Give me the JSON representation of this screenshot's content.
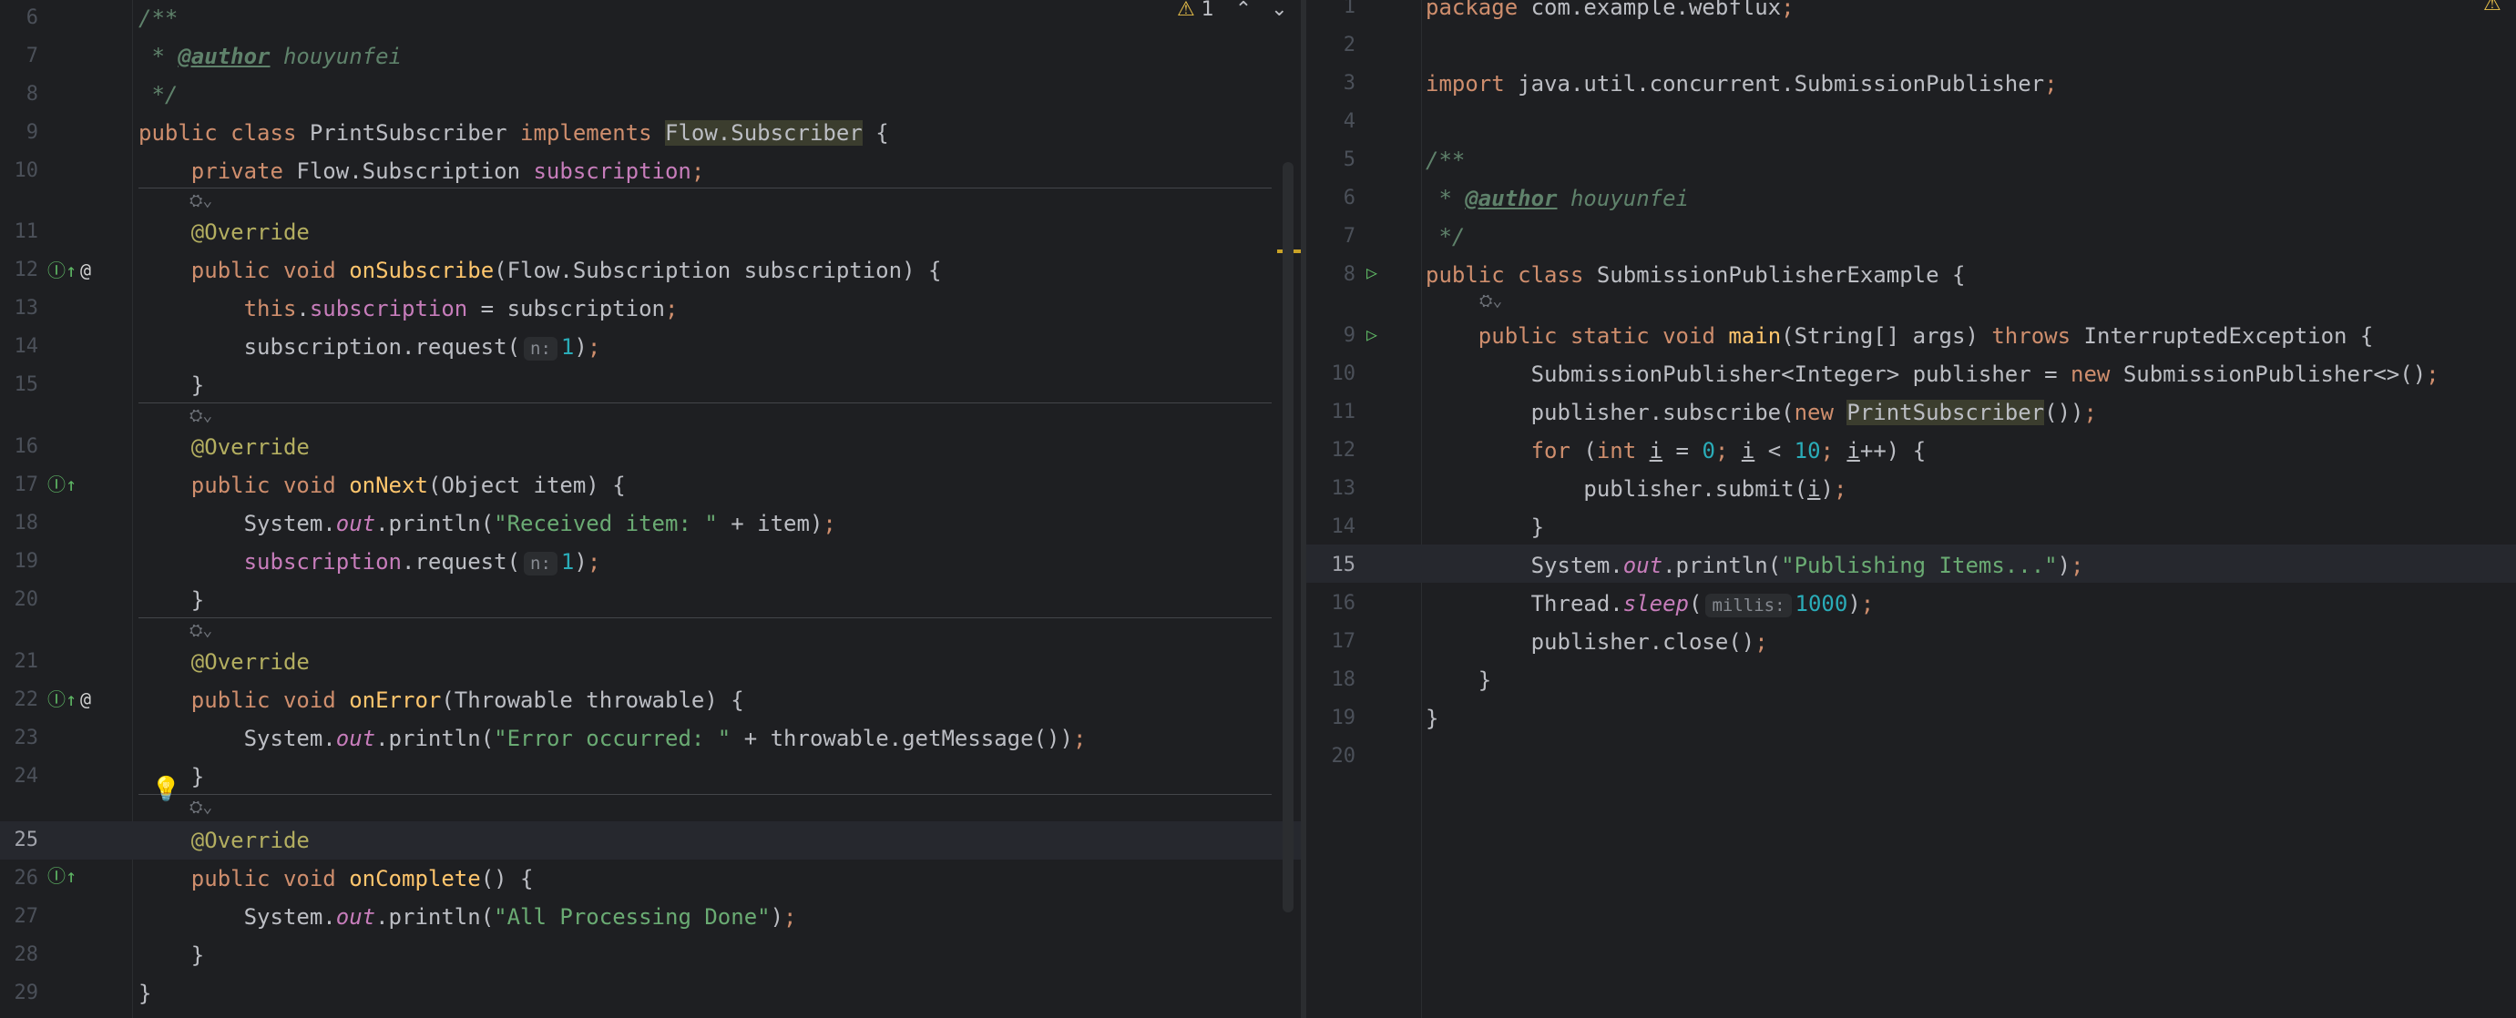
{
  "left": {
    "warnings": {
      "count": "1",
      "icon": "warning-icon"
    },
    "lines": [
      {
        "n": "6",
        "tokens": [
          [
            "/**",
            "cmt2"
          ]
        ]
      },
      {
        "n": "7",
        "tokens": [
          [
            " * ",
            "cmt2"
          ],
          [
            "@author",
            "tag"
          ],
          [
            " houyunfei",
            "cmt2"
          ]
        ]
      },
      {
        "n": "8",
        "tokens": [
          [
            " */",
            "cmt2"
          ]
        ]
      },
      {
        "n": "9",
        "tokens": [
          [
            "public ",
            "kw"
          ],
          [
            "class ",
            "kw"
          ],
          [
            "PrintSubscriber ",
            "cls"
          ],
          [
            "implements ",
            "kw"
          ],
          [
            "Flow.Subscriber",
            "hl"
          ],
          [
            " {",
            ""
          ]
        ]
      },
      {
        "n": "10",
        "tokens": [
          [
            "    private ",
            "kw"
          ],
          [
            "Flow.Subscription ",
            "cls"
          ],
          [
            "subscription",
            "fld"
          ],
          [
            ";",
            "kw"
          ]
        ]
      },
      {
        "n": "11",
        "tokens": [
          [
            "    @Override",
            "ann"
          ]
        ]
      },
      {
        "n": "12",
        "tokens": [
          [
            "    public ",
            "kw"
          ],
          [
            "void ",
            "kw"
          ],
          [
            "onSubscribe",
            "fn2"
          ],
          [
            "(Flow.Subscription subscription) {",
            ""
          ]
        ]
      },
      {
        "n": "13",
        "tokens": [
          [
            "        this",
            "kw"
          ],
          [
            ".",
            ""
          ],
          [
            "subscription",
            "fld"
          ],
          [
            " = subscription",
            ""
          ],
          [
            ";",
            "kw"
          ]
        ]
      },
      {
        "n": "14",
        "tokens": [
          [
            "        subscription.request(",
            ""
          ],
          [
            "n:",
            "inl"
          ],
          [
            "1",
            "num2"
          ],
          [
            ")",
            ""
          ],
          [
            ";",
            "kw"
          ]
        ]
      },
      {
        "n": "15",
        "tokens": [
          [
            "    }",
            ""
          ]
        ]
      },
      {
        "n": "16",
        "tokens": [
          [
            "    @Override",
            "ann"
          ]
        ]
      },
      {
        "n": "17",
        "tokens": [
          [
            "    public ",
            "kw"
          ],
          [
            "void ",
            "kw"
          ],
          [
            "onNext",
            "fn2"
          ],
          [
            "(Object item) {",
            ""
          ]
        ]
      },
      {
        "n": "18",
        "tokens": [
          [
            "        System.",
            ""
          ],
          [
            "out",
            "stat"
          ],
          [
            ".println(",
            ""
          ],
          [
            "\"Received item: \"",
            "str"
          ],
          [
            " + item)",
            ""
          ],
          [
            ";",
            "kw"
          ]
        ]
      },
      {
        "n": "19",
        "tokens": [
          [
            "        ",
            ""
          ],
          [
            "subscription",
            "fld"
          ],
          [
            ".request(",
            ""
          ],
          [
            "n:",
            "inl"
          ],
          [
            "1",
            "num2"
          ],
          [
            ")",
            ""
          ],
          [
            ";",
            "kw"
          ]
        ]
      },
      {
        "n": "20",
        "tokens": [
          [
            "    }",
            ""
          ]
        ]
      },
      {
        "n": "21",
        "tokens": [
          [
            "    @Override",
            "ann"
          ]
        ]
      },
      {
        "n": "22",
        "tokens": [
          [
            "    public ",
            "kw"
          ],
          [
            "void ",
            "kw"
          ],
          [
            "onError",
            "fn2"
          ],
          [
            "(Throwable throwable) {",
            ""
          ]
        ]
      },
      {
        "n": "23",
        "tokens": [
          [
            "        System.",
            ""
          ],
          [
            "out",
            "stat"
          ],
          [
            ".println(",
            ""
          ],
          [
            "\"Error occurred: \"",
            "str"
          ],
          [
            " + throwable.getMessage())",
            ""
          ],
          [
            ";",
            "kw"
          ]
        ]
      },
      {
        "n": "24",
        "tokens": [
          [
            "    }",
            ""
          ]
        ]
      },
      {
        "n": "25",
        "tokens": [
          [
            "    @Override",
            "ann"
          ]
        ]
      },
      {
        "n": "26",
        "tokens": [
          [
            "    public ",
            "kw"
          ],
          [
            "void ",
            "kw"
          ],
          [
            "onComplete",
            "fn2"
          ],
          [
            "() {",
            ""
          ]
        ]
      },
      {
        "n": "27",
        "tokens": [
          [
            "        System.",
            ""
          ],
          [
            "out",
            "stat"
          ],
          [
            ".println(",
            ""
          ],
          [
            "\"All Processing Done\"",
            "str"
          ],
          [
            ")",
            ""
          ],
          [
            ";",
            "kw"
          ]
        ]
      },
      {
        "n": "28",
        "tokens": [
          [
            "    }",
            ""
          ]
        ]
      },
      {
        "n": "29",
        "tokens": [
          [
            "}",
            ""
          ]
        ]
      }
    ]
  },
  "right": {
    "lines": [
      {
        "n": "1",
        "tokens": [
          [
            "package ",
            "kw"
          ],
          [
            "com.example.webflux",
            ""
          ],
          [
            ";",
            "kw"
          ]
        ]
      },
      {
        "n": "2",
        "tokens": []
      },
      {
        "n": "3",
        "tokens": [
          [
            "import ",
            "kw"
          ],
          [
            "java.util.concurrent.SubmissionPublisher",
            ""
          ],
          [
            ";",
            "kw"
          ]
        ]
      },
      {
        "n": "4",
        "tokens": []
      },
      {
        "n": "5",
        "tokens": [
          [
            "/**",
            "cmt2"
          ]
        ]
      },
      {
        "n": "6",
        "tokens": [
          [
            " * ",
            "cmt2"
          ],
          [
            "@author",
            "tag"
          ],
          [
            " houyunfei",
            "cmt2"
          ]
        ]
      },
      {
        "n": "7",
        "tokens": [
          [
            " */",
            "cmt2"
          ]
        ]
      },
      {
        "n": "8",
        "tokens": [
          [
            "public ",
            "kw"
          ],
          [
            "class ",
            "kw"
          ],
          [
            "SubmissionPublisherExample {",
            ""
          ]
        ]
      },
      {
        "n": "9",
        "tokens": [
          [
            "    public ",
            "kw"
          ],
          [
            "static ",
            "kw"
          ],
          [
            "void ",
            "kw"
          ],
          [
            "main",
            "fn2"
          ],
          [
            "(String[] args) ",
            ""
          ],
          [
            "throws ",
            "kw"
          ],
          [
            "InterruptedException {",
            ""
          ]
        ]
      },
      {
        "n": "10",
        "tokens": [
          [
            "        SubmissionPublisher<Integer> publisher = ",
            ""
          ],
          [
            "new ",
            "kw"
          ],
          [
            "SubmissionPublisher<>()",
            ""
          ],
          [
            ";",
            "kw"
          ]
        ]
      },
      {
        "n": "11",
        "tokens": [
          [
            "        publisher.subscribe(",
            ""
          ],
          [
            "new ",
            "kw"
          ],
          [
            "PrintSubscriber",
            "hl"
          ],
          [
            "())",
            ""
          ],
          [
            ";",
            "kw"
          ]
        ]
      },
      {
        "n": "12",
        "tokens": [
          [
            "        ",
            ""
          ],
          [
            "for ",
            "kw"
          ],
          [
            "(",
            ""
          ],
          [
            "int ",
            "kw"
          ],
          [
            "i",
            "ul"
          ],
          [
            " = ",
            ""
          ],
          [
            "0",
            "num2"
          ],
          [
            "; ",
            "kw"
          ],
          [
            "i",
            "ul"
          ],
          [
            " < ",
            ""
          ],
          [
            "10",
            "num2"
          ],
          [
            "; ",
            "kw"
          ],
          [
            "i",
            "ul"
          ],
          [
            "++) {",
            ""
          ]
        ]
      },
      {
        "n": "13",
        "tokens": [
          [
            "            publisher.submit(",
            ""
          ],
          [
            "i",
            "ul"
          ],
          [
            ")",
            ""
          ],
          [
            ";",
            "kw"
          ]
        ]
      },
      {
        "n": "14",
        "tokens": [
          [
            "        }",
            ""
          ]
        ]
      },
      {
        "n": "15",
        "tokens": [
          [
            "        System.",
            ""
          ],
          [
            "out",
            "stat"
          ],
          [
            ".println(",
            ""
          ],
          [
            "\"Publishing Items...\"",
            "str"
          ],
          [
            ")",
            ""
          ],
          [
            ";",
            "kw"
          ]
        ]
      },
      {
        "n": "16",
        "tokens": [
          [
            "        Thread.",
            ""
          ],
          [
            "sleep",
            "stat"
          ],
          [
            "(",
            ""
          ],
          [
            "millis:",
            "inl"
          ],
          [
            "1000",
            "num2"
          ],
          [
            ")",
            ""
          ],
          [
            ";",
            "kw"
          ]
        ]
      },
      {
        "n": "17",
        "tokens": [
          [
            "        publisher.close()",
            ""
          ],
          [
            ";",
            "kw"
          ]
        ]
      },
      {
        "n": "18",
        "tokens": [
          [
            "    }",
            ""
          ]
        ]
      },
      {
        "n": "19",
        "tokens": [
          [
            "}",
            ""
          ]
        ]
      },
      {
        "n": "20",
        "tokens": []
      }
    ]
  }
}
